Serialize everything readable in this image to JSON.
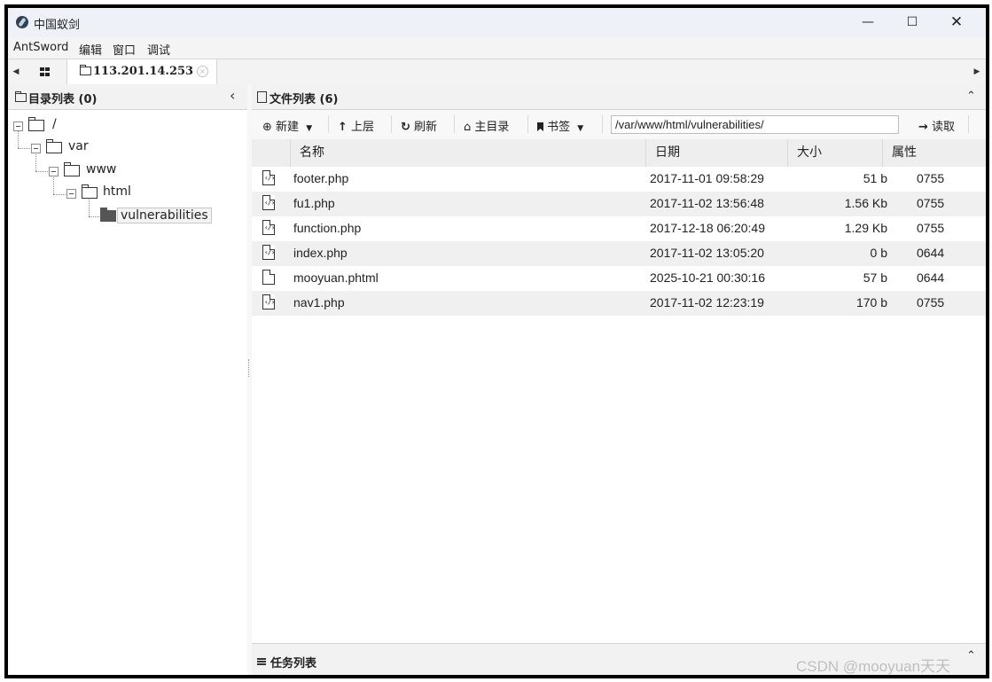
{
  "window": {
    "title": "中国蚁剑",
    "min": "—",
    "max": "☐",
    "close": "✕"
  },
  "menu": [
    "AntSword",
    "编辑",
    "窗口",
    "调试"
  ],
  "tabs": {
    "host": "113.201.14.253",
    "close": "×",
    "left_arrow": "◀",
    "right_arrow": "▶"
  },
  "dir_panel": {
    "title": "目录列表 (0)",
    "collapse": "‹"
  },
  "tree": {
    "root": "/",
    "n1": "var",
    "n2": "www",
    "n3": "html",
    "n4": "vulnerabilities"
  },
  "file_panel": {
    "title": "文件列表 (6)",
    "collapse": "⌃"
  },
  "toolbar": {
    "new": "新建",
    "up": "上层",
    "refresh": "刷新",
    "home": "主目录",
    "bookmark": "书签",
    "path": "/var/www/html/vulnerabilities/",
    "read": "读取"
  },
  "columns": {
    "name": "名称",
    "date": "日期",
    "size": "大小",
    "perm": "属性"
  },
  "files": [
    {
      "icon": "php-file-icon",
      "name": "footer.php",
      "date": "2017-11-01 09:58:29",
      "size": "51 b",
      "perm": "0755"
    },
    {
      "icon": "php-file-icon",
      "name": "fu1.php",
      "date": "2017-11-02 13:56:48",
      "size": "1.56 Kb",
      "perm": "0755"
    },
    {
      "icon": "php-file-icon",
      "name": "function.php",
      "date": "2017-12-18 06:20:49",
      "size": "1.29 Kb",
      "perm": "0755"
    },
    {
      "icon": "php-file-icon",
      "name": "index.php",
      "date": "2017-11-02 13:05:20",
      "size": "0 b",
      "perm": "0644"
    },
    {
      "icon": "blank-file-icon",
      "name": "mooyuan.phtml",
      "date": "2025-10-21 00:30:16",
      "size": "57 b",
      "perm": "0644"
    },
    {
      "icon": "php-file-icon",
      "name": "nav1.php",
      "date": "2017-11-02 12:23:19",
      "size": "170 b",
      "perm": "0755"
    }
  ],
  "task_panel": {
    "title": "任务列表",
    "collapse": "⌃"
  },
  "watermark": "CSDN @mooyuan天天"
}
